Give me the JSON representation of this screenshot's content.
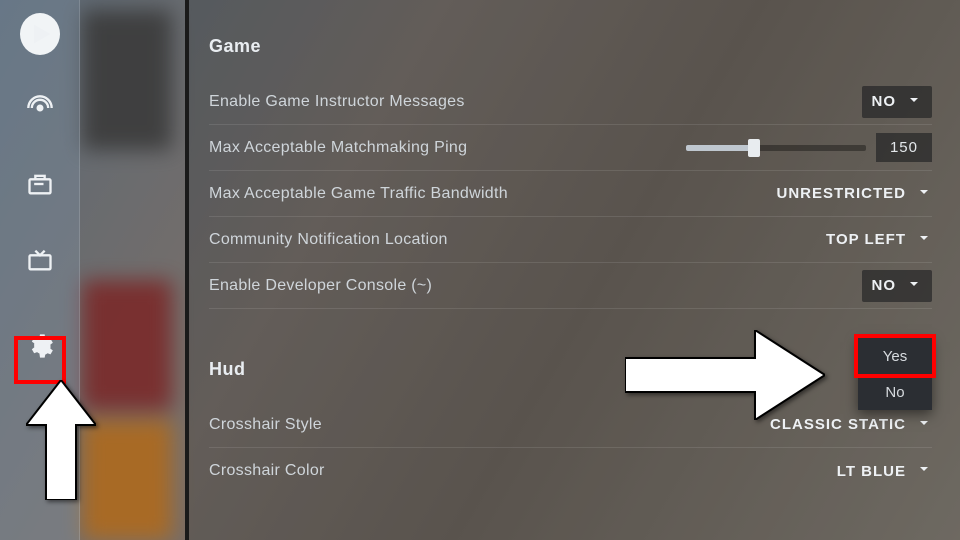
{
  "sections": {
    "game_title": "Game",
    "hud_title": "Hud"
  },
  "settings": {
    "instructor": {
      "label": "Enable Game Instructor Messages",
      "value": "NO"
    },
    "ping": {
      "label": "Max Acceptable Matchmaking Ping",
      "value": "150"
    },
    "bandwidth": {
      "label": "Max Acceptable Game Traffic Bandwidth",
      "value": "UNRESTRICTED"
    },
    "community_loc": {
      "label": "Community Notification Location",
      "value": "TOP LEFT"
    },
    "dev_console": {
      "label": "Enable Developer Console (~)",
      "value": "NO"
    },
    "crosshair_style": {
      "label": "Crosshair Style",
      "value": "CLASSIC STATIC"
    },
    "crosshair_color": {
      "label": "Crosshair Color",
      "value": "LT BLUE"
    }
  },
  "dropdown": {
    "opt_yes": "Yes",
    "opt_no": "No"
  },
  "icons": {
    "play": "play",
    "broadcast": "broadcast",
    "inventory": "inventory",
    "watch": "watch",
    "settings": "settings"
  }
}
